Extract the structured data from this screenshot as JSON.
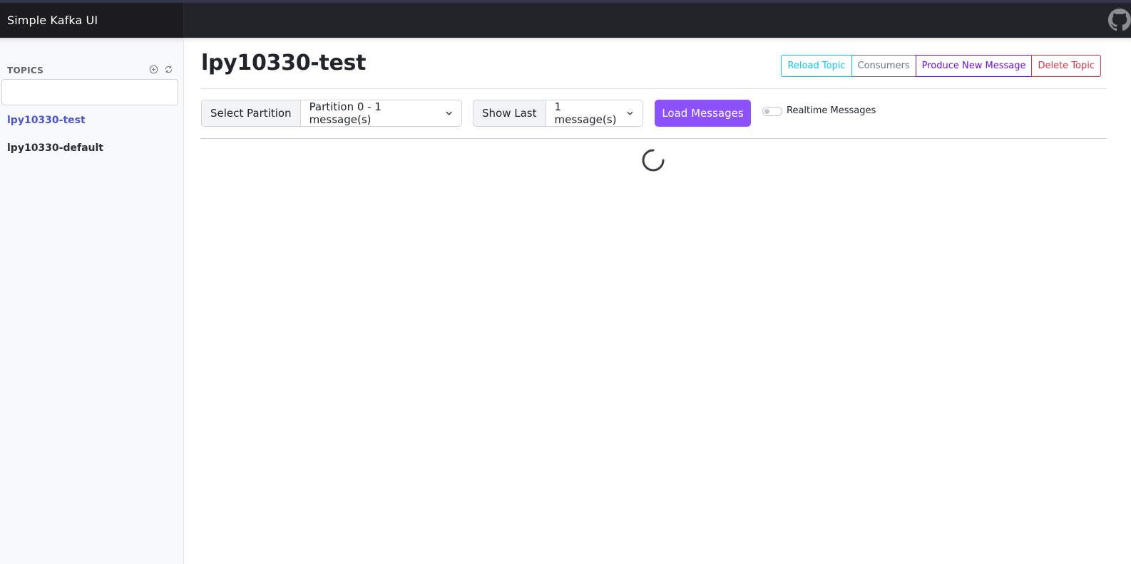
{
  "app": {
    "title": "Simple Kafka UI",
    "github_icon": "github-icon"
  },
  "sidebar": {
    "heading": "TOPICS",
    "search": {
      "value": "",
      "placeholder": ""
    },
    "icons": [
      "add-circle-icon",
      "refresh-icon"
    ],
    "topics": [
      {
        "label": "lpy10330-test",
        "active": true
      },
      {
        "label": "lpy10330-default",
        "active": false
      }
    ]
  },
  "main": {
    "title": "lpy10330-test",
    "actions": {
      "reload": "Reload Topic",
      "consumers": "Consumers",
      "produce": "Produce New Message",
      "delete": "Delete Topic"
    },
    "partition": {
      "label": "Select Partition",
      "selected": "Partition 0 - 1 message(s)"
    },
    "show_last": {
      "label": "Show Last",
      "selected": "1 message(s)"
    },
    "load_button": "Load Messages",
    "realtime": {
      "label": "Realtime Messages",
      "enabled": false
    },
    "loading": true
  },
  "colors": {
    "topbar": "#212529",
    "accent_purple": "#8c52ff",
    "active_topic": "#4a55cf",
    "reload": "#0dcaf0",
    "consumers": "#6c757d",
    "produce": "#6610f2",
    "delete": "#dc3545"
  }
}
